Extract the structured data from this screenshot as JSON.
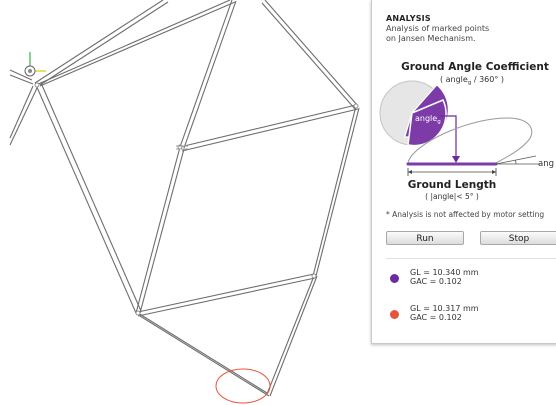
{
  "panel": {
    "title": "ANALYSIS",
    "description_line1": "Analysis of marked points",
    "description_line2": "on Jansen Mechanism.",
    "gac_heading": "Ground Angle Coefficient",
    "gac_formula_prefix": "( angle",
    "gac_formula_sub": "g",
    "gac_formula_suffix": " / 360° )",
    "pie_label": "angle",
    "pie_label_sub": "g",
    "gl_heading": "Ground Length",
    "gl_condition": "( |angle|< 5° )",
    "angle_label": "ang",
    "note": "* Analysis is not affected by motor setting",
    "run_label": "Run",
    "stop_label": "Stop",
    "results": [
      {
        "gl": "GL = 10.340 mm",
        "gac": "GAC = 0.102",
        "color": "#6a2aa0"
      },
      {
        "gl": "GL = 10.317 mm",
        "gac": "GAC = 0.102",
        "color": "#e8523a"
      }
    ]
  },
  "colors": {
    "accent_purple": "#7d3ba8",
    "pie_gray": "#e6e6e6",
    "link_stroke": "#6e6e6e",
    "marker_red": "#e8523a",
    "axis_green": "#3cb043",
    "axis_yellow": "#e3c400"
  }
}
